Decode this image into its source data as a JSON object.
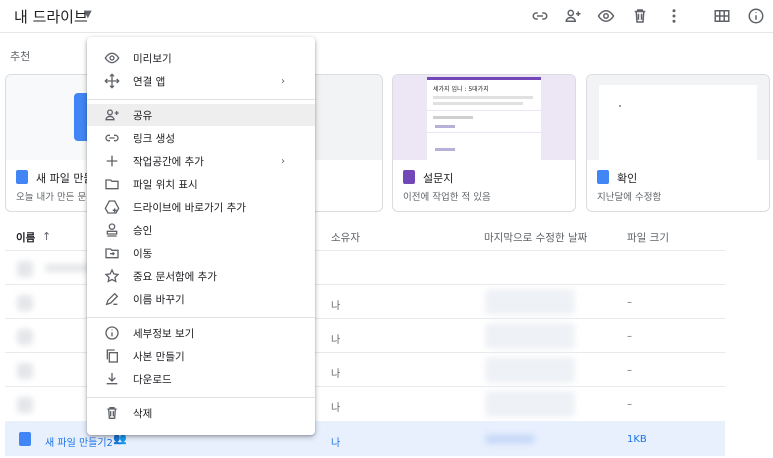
{
  "header": {
    "title": "내 드라이브",
    "toolbar_icons": [
      "link-icon",
      "add-person-icon",
      "eye-icon",
      "trash-icon",
      "more-vert-icon",
      "grid-view-icon",
      "info-icon"
    ]
  },
  "suggested": {
    "label": "추천",
    "cards": [
      {
        "title": "새 파일 만들기",
        "subtitle": "오늘 내가 만든 문서",
        "icon_color": "#4285f4"
      },
      {
        "title": "",
        "subtitle": "",
        "icon_color": "#4285f4"
      },
      {
        "title": "설문지",
        "subtitle": "이전에 작업한 적 있음",
        "icon_color": "#7248b9",
        "thumb_text": "세가지 입니 : 5대가지"
      },
      {
        "title": "확인",
        "subtitle": "지난달에 수정함",
        "icon_color": "#4285f4"
      }
    ]
  },
  "file_list": {
    "columns": {
      "name": "이름",
      "owner": "소유자",
      "modified": "마지막으로 수정한 날짜",
      "size": "파일 크기"
    },
    "rows": [
      {
        "owner": "",
        "size": ""
      },
      {
        "owner": "나",
        "size": "–"
      },
      {
        "owner": "나",
        "size": "–"
      },
      {
        "owner": "나",
        "size": "–"
      },
      {
        "owner": "나",
        "size": "–"
      },
      {
        "name": "새 파일 만들기2",
        "owner": "나",
        "size": "1KB",
        "selected": true
      }
    ]
  },
  "context_menu": {
    "items": [
      {
        "label": "미리보기",
        "icon": "eye-icon"
      },
      {
        "label": "연결 앱",
        "icon": "move-icon",
        "submenu": true
      },
      {
        "label": "공유",
        "icon": "add-person-icon",
        "highlight": true
      },
      {
        "label": "링크 생성",
        "icon": "link-icon"
      },
      {
        "label": "작업공간에 추가",
        "icon": "plus-icon",
        "submenu": true
      },
      {
        "label": "파일 위치 표시",
        "icon": "folder-icon"
      },
      {
        "label": "드라이브에 바로가기 추가",
        "icon": "drive-shortcut-icon"
      },
      {
        "label": "승인",
        "icon": "approval-icon"
      },
      {
        "label": "이동",
        "icon": "move-to-icon"
      },
      {
        "label": "중요 문서함에 추가",
        "icon": "star-icon"
      },
      {
        "label": "이름 바꾸기",
        "icon": "pencil-icon"
      },
      {
        "label": "세부정보 보기",
        "icon": "info-icon"
      },
      {
        "label": "사본 만들기",
        "icon": "copy-icon"
      },
      {
        "label": "다운로드",
        "icon": "download-icon"
      },
      {
        "label": "삭제",
        "icon": "trash-icon"
      }
    ]
  },
  "colors": {
    "accent": "#1a73e8",
    "selected_row": "#e8f0fe",
    "forms_purple": "#7248b9"
  }
}
